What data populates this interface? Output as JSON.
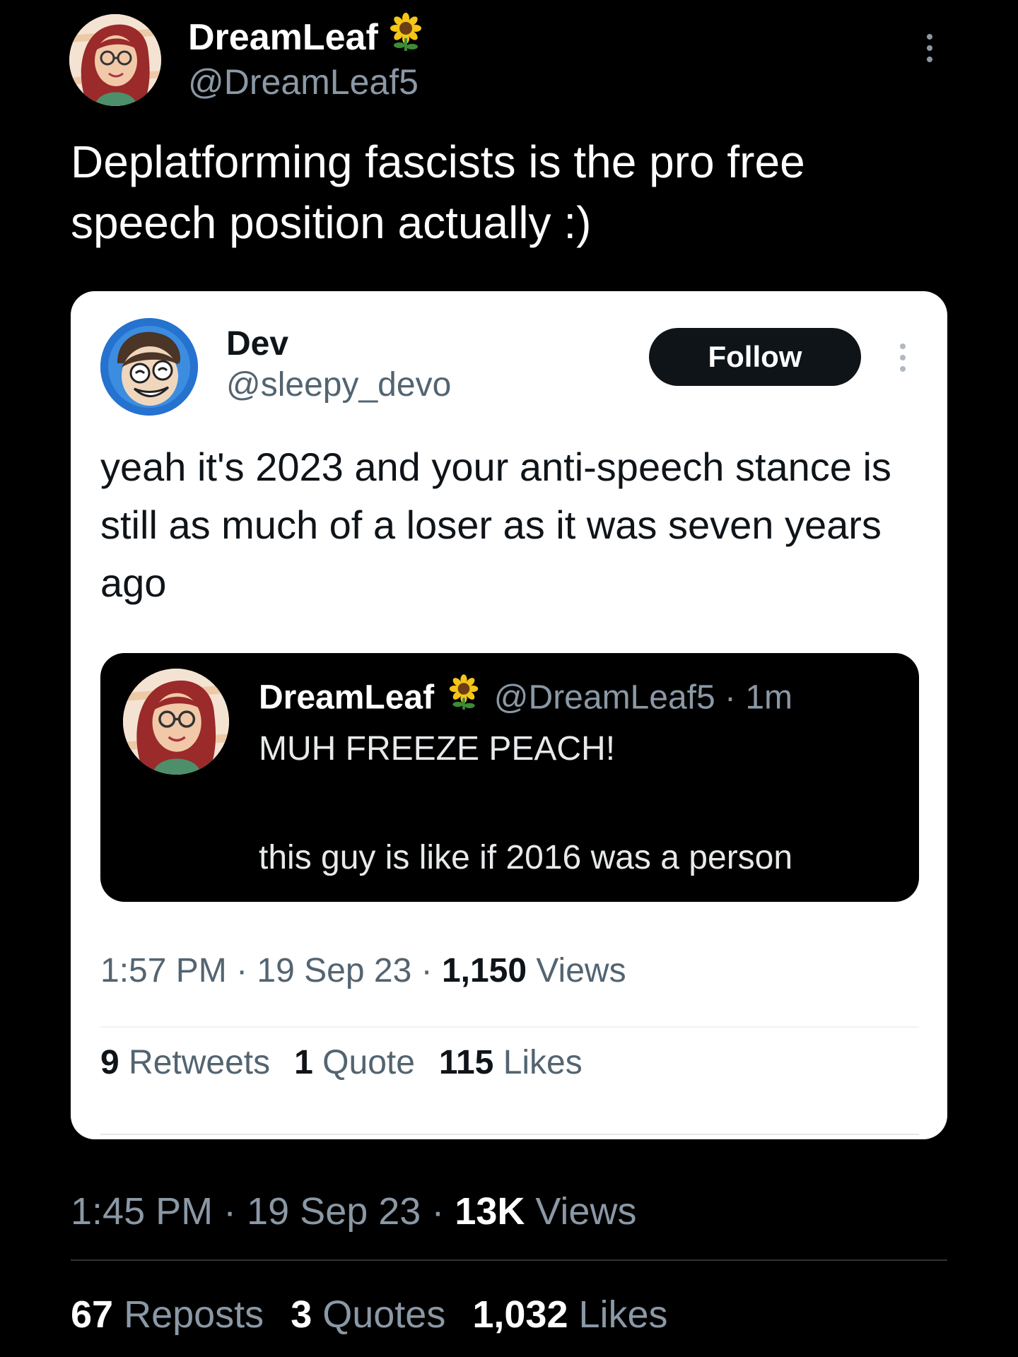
{
  "post": {
    "author": {
      "display_name": "DreamLeaf",
      "handle": "@DreamLeaf5",
      "name_emoji": "sunflower-icon"
    },
    "text": "Deplatforming fascists is the pro free speech position actually :)",
    "meta": {
      "time": "1:45 PM",
      "sep1": " · ",
      "date": "19 Sep 23",
      "sep2": " · ",
      "views_value": "13K",
      "views_label": " Views"
    },
    "stats": {
      "reposts_value": "67",
      "reposts_label": " Reposts",
      "quotes_value": "3",
      "quotes_label": " Quotes",
      "likes_value": "1,032",
      "likes_label": " Likes"
    }
  },
  "embedded": {
    "author": {
      "display_name": "Dev",
      "handle": "@sleepy_devo"
    },
    "follow_label": "Follow",
    "text": "yeah it's 2023 and your anti-speech stance is still as much of a loser as it was seven years ago",
    "quoted": {
      "display_name": "DreamLeaf",
      "handle_time": "@DreamLeaf5 · 1m",
      "line1": "MUH FREEZE PEACH!",
      "line2": "this guy is like if 2016 was a person"
    },
    "meta": {
      "time": "1:57 PM",
      "sep1": " · ",
      "date": "19 Sep 23",
      "sep2": " · ",
      "views_value": "1,150",
      "views_label": " Views"
    },
    "stats": {
      "retweets_value": "9",
      "retweets_label": " Retweets",
      "quote_value": "1",
      "quote_label": " Quote",
      "likes_value": "115",
      "likes_label": " Likes"
    }
  },
  "colors": {
    "background": "#000000",
    "card": "#ffffff",
    "muted_dark": "#8b98a5",
    "muted_light": "#536471"
  }
}
